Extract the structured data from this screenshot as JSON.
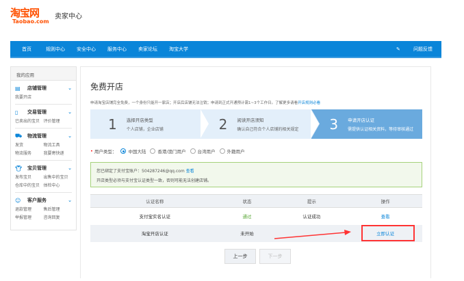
{
  "header": {
    "logo_cn": "淘宝网",
    "logo_en": "Taobao.com",
    "title": "卖家中心"
  },
  "nav": {
    "items": [
      "首页",
      "规则中心",
      "安全中心",
      "服务中心",
      "卖家论坛",
      "淘宝大学"
    ],
    "feedback": "问题反馈"
  },
  "sidebar": {
    "heading": "我的应用",
    "groups": [
      {
        "title": "店铺管理",
        "links": [
          "我要开店"
        ]
      },
      {
        "title": "交易管理",
        "links": [
          "已卖出的宝贝",
          "评价管理"
        ]
      },
      {
        "title": "物流管理",
        "links": [
          "发货",
          "物流工具",
          "物流服务",
          "我要寄快递"
        ]
      },
      {
        "title": "宝贝管理",
        "links": [
          "发布宝贝",
          "出售中的宝贝",
          "仓库中的宝贝",
          "体检中心"
        ]
      },
      {
        "title": "客户服务",
        "links": [
          "退款管理",
          "售后管理",
          "举报管理",
          "咨询回复"
        ]
      }
    ]
  },
  "main": {
    "title": "免费开店",
    "desc": "申请淘宝店铺完全免费，一个身份只能开一家店；开店后店铺无法注销；申请到正式开通预计需1~3个工作日。了解更多请看",
    "desc_link": "开店规则必看",
    "steps": [
      {
        "num": "1",
        "title": "选择开店类型",
        "sub": "个人店铺，企业店铺"
      },
      {
        "num": "2",
        "title": "阅读开店须知",
        "sub": "确认自己符合个人店铺的相关规定"
      },
      {
        "num": "3",
        "title": "申请开店认证",
        "sub": "需提供认证相关资料，等待审核通过"
      }
    ],
    "user_type_label": "用户类型：",
    "user_types": [
      "中国大陆",
      "香港/澳门用户",
      "台湾用户",
      "外籍用户"
    ],
    "selected_user_type": "中国大陆",
    "notice_line1": "您已绑定了支付宝账户：504287246@qq.com",
    "notice_link": "查看",
    "notice_line2": "开店类型必须与支付宝认证类型一致，否则可能无法创建店铺。",
    "table": {
      "headers": [
        "认证名称",
        "状态",
        "提示",
        "操作"
      ],
      "rows": [
        [
          "支付宝实名认证",
          "通过",
          "认证成功",
          "查看"
        ],
        [
          "淘宝开店认证",
          "未开始",
          "",
          "立即认证"
        ]
      ]
    },
    "prev": "上一步",
    "next": "下一步"
  },
  "colors": {
    "brand": "#ff5000",
    "nav": "#0a85d9",
    "highlight": "#ff3333"
  }
}
